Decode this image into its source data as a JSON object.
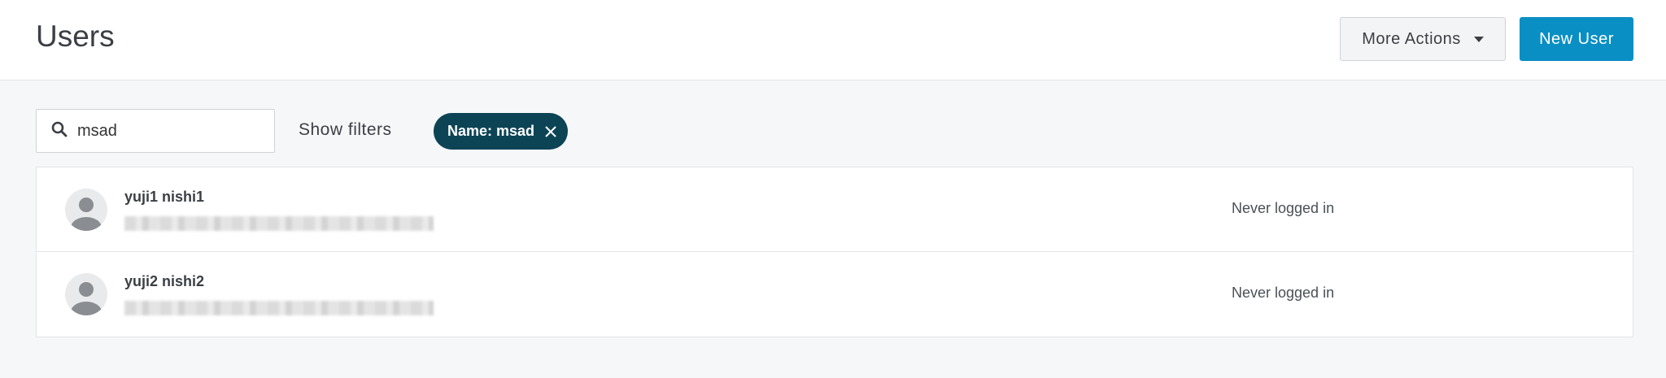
{
  "header": {
    "title": "Users",
    "more_actions_label": "More Actions",
    "new_user_label": "New User"
  },
  "toolbar": {
    "search_value": "msad",
    "show_filters_label": "Show filters",
    "active_filter_chip": "Name: msad"
  },
  "users": [
    {
      "name": "yuji1 nishi1",
      "status": "Never logged in"
    },
    {
      "name": "yuji2 nishi2",
      "status": "Never logged in"
    }
  ],
  "colors": {
    "primary_button": "#0a8fc4",
    "filter_chip": "#0c4456"
  }
}
